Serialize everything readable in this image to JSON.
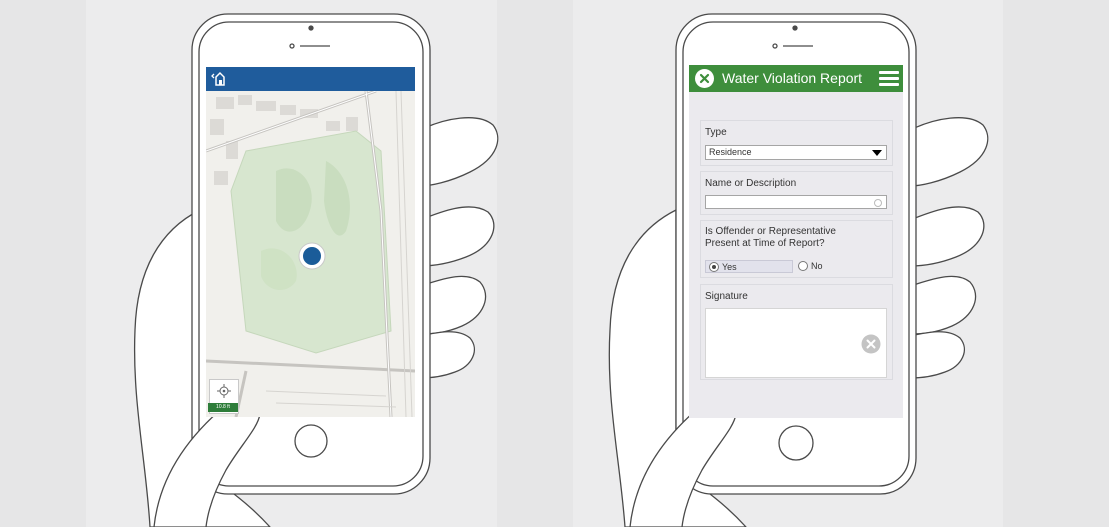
{
  "map_app": {
    "header_color": "#1f5c9c",
    "home_icon": "home-back-icon",
    "locate_icon": "crosshair-icon",
    "scale_label": "10.8 ft",
    "location_marker_color": "#1a5c99"
  },
  "form_app": {
    "header_color": "#3e8e3c",
    "title": "Water Violation Report",
    "close_icon": "close-icon",
    "menu_icon": "hamburger-menu-icon",
    "fields": {
      "type": {
        "label": "Type",
        "value": "Residence"
      },
      "name": {
        "label": "Name or Description",
        "value": ""
      },
      "present": {
        "label_line1": "Is Offender or Representative",
        "label_line2": "Present at Time of Report?",
        "options": [
          "Yes",
          "No"
        ],
        "selected": "Yes"
      },
      "signature": {
        "label": "Signature"
      }
    }
  }
}
